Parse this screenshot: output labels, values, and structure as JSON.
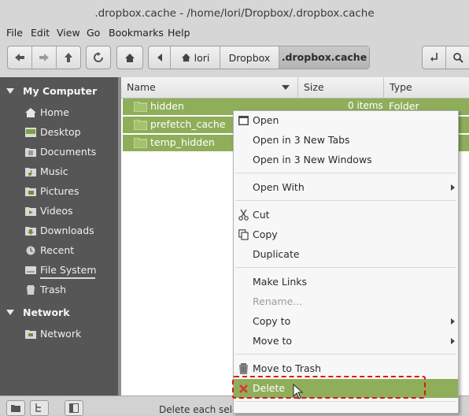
{
  "window": {
    "title": ".dropbox.cache - /home/lori/Dropbox/.dropbox.cache"
  },
  "menubar": {
    "items": [
      "File",
      "Edit",
      "View",
      "Go",
      "Bookmarks",
      "Help"
    ]
  },
  "breadcrumbs": [
    "lori",
    "Dropbox",
    ".dropbox.cache"
  ],
  "sidebar": {
    "sections": [
      {
        "title": "My Computer",
        "items": [
          {
            "label": "Home",
            "icon": "home-icon"
          },
          {
            "label": "Desktop",
            "icon": "desktop-icon"
          },
          {
            "label": "Documents",
            "icon": "documents-folder-icon"
          },
          {
            "label": "Music",
            "icon": "music-folder-icon"
          },
          {
            "label": "Pictures",
            "icon": "pictures-folder-icon"
          },
          {
            "label": "Videos",
            "icon": "videos-folder-icon"
          },
          {
            "label": "Downloads",
            "icon": "downloads-folder-icon"
          },
          {
            "label": "Recent",
            "icon": "recent-icon"
          },
          {
            "label": "File System",
            "icon": "drive-icon"
          },
          {
            "label": "Trash",
            "icon": "trash-icon"
          }
        ]
      },
      {
        "title": "Network",
        "items": [
          {
            "label": "Network",
            "icon": "network-icon"
          }
        ]
      }
    ]
  },
  "columns": {
    "name": "Name",
    "size": "Size",
    "type": "Type"
  },
  "files": [
    {
      "name": "hidden",
      "size": "0 items",
      "type": "Folder"
    },
    {
      "name": "prefetch_cache",
      "size": "",
      "type": ""
    },
    {
      "name": "temp_hidden",
      "size": "",
      "type": ""
    }
  ],
  "context_menu": {
    "open": "Open",
    "open_tabs": "Open in 3 New Tabs",
    "open_windows": "Open in 3 New Windows",
    "open_with": "Open With",
    "cut": "Cut",
    "copy": "Copy",
    "duplicate": "Duplicate",
    "make_links": "Make Links",
    "rename": "Rename...",
    "copy_to": "Copy to",
    "move_to": "Move to",
    "move_to_trash": "Move to Trash",
    "delete": "Delete"
  },
  "status": {
    "text": "Delete each sele"
  },
  "colors": {
    "accent": "#8fae5a",
    "sidebar_bg": "#565656",
    "highlight_box": "#e01616"
  }
}
